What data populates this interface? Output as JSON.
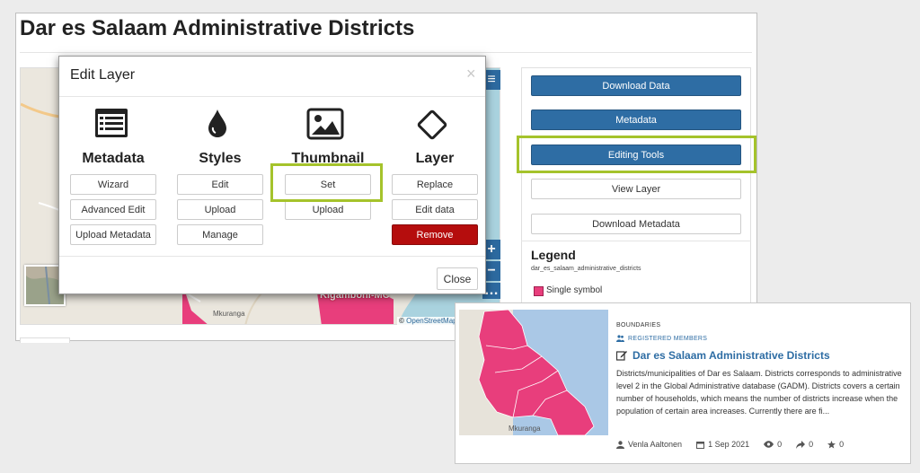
{
  "page": {
    "title": "Dar es Salaam Administrative Districts"
  },
  "map": {
    "attribution_prefix": "©",
    "attribution_link": "OpenStreetMap",
    "labels": {
      "mkuranga": "Mkuranga",
      "kigamboni": "Kigamboni-MC"
    },
    "controls": {
      "menu": "≡",
      "zoom_in": "+",
      "zoom_out": "−",
      "more": "…"
    }
  },
  "panel": {
    "buttons": {
      "download_data": "Download Data",
      "metadata": "Metadata",
      "editing_tools": "Editing Tools",
      "view_layer": "View Layer",
      "download_metadata": "Download Metadata"
    },
    "legend": {
      "title": "Legend",
      "layer_name": "dar_es_salaam_administrative_districts",
      "item": "Single symbol",
      "swatch_color": "#e83e7c"
    }
  },
  "modal": {
    "title": "Edit Layer",
    "close_x": "×",
    "close_button": "Close",
    "columns": {
      "metadata": {
        "heading": "Metadata",
        "icon": "list-icon",
        "buttons": [
          "Wizard",
          "Advanced Edit",
          "Upload Metadata"
        ]
      },
      "styles": {
        "heading": "Styles",
        "icon": "droplet-icon",
        "buttons": [
          "Edit",
          "Upload",
          "Manage"
        ]
      },
      "thumbnail": {
        "heading": "Thumbnail",
        "icon": "image-icon",
        "buttons": [
          "Set",
          "Upload"
        ]
      },
      "layer": {
        "heading": "Layer",
        "icon": "diamond-icon",
        "buttons": [
          "Replace",
          "Edit data",
          "Remove"
        ]
      }
    }
  },
  "card": {
    "category": "BOUNDARIES",
    "registered": "REGISTERED MEMBERS",
    "title": "Dar es Salaam Administrative Districts",
    "description": "Districts/municipalities of Dar es Salaam. Districts corresponds to administrative level 2 in the Global Administrative database (GADM). Districts covers a certain number of households, which means the number of districts increase when the population of certain area increases. Currently there are fi...",
    "author": "Venla Aaltonen",
    "date": "1 Sep 2021",
    "views": "0",
    "shares": "0",
    "stars": "0",
    "thumb_label": "Mkuranga"
  },
  "colors": {
    "accent_blue": "#2e6da4",
    "highlight": "#a5c32b",
    "danger": "#b50d0d",
    "district_pink": "#e83e7c"
  }
}
